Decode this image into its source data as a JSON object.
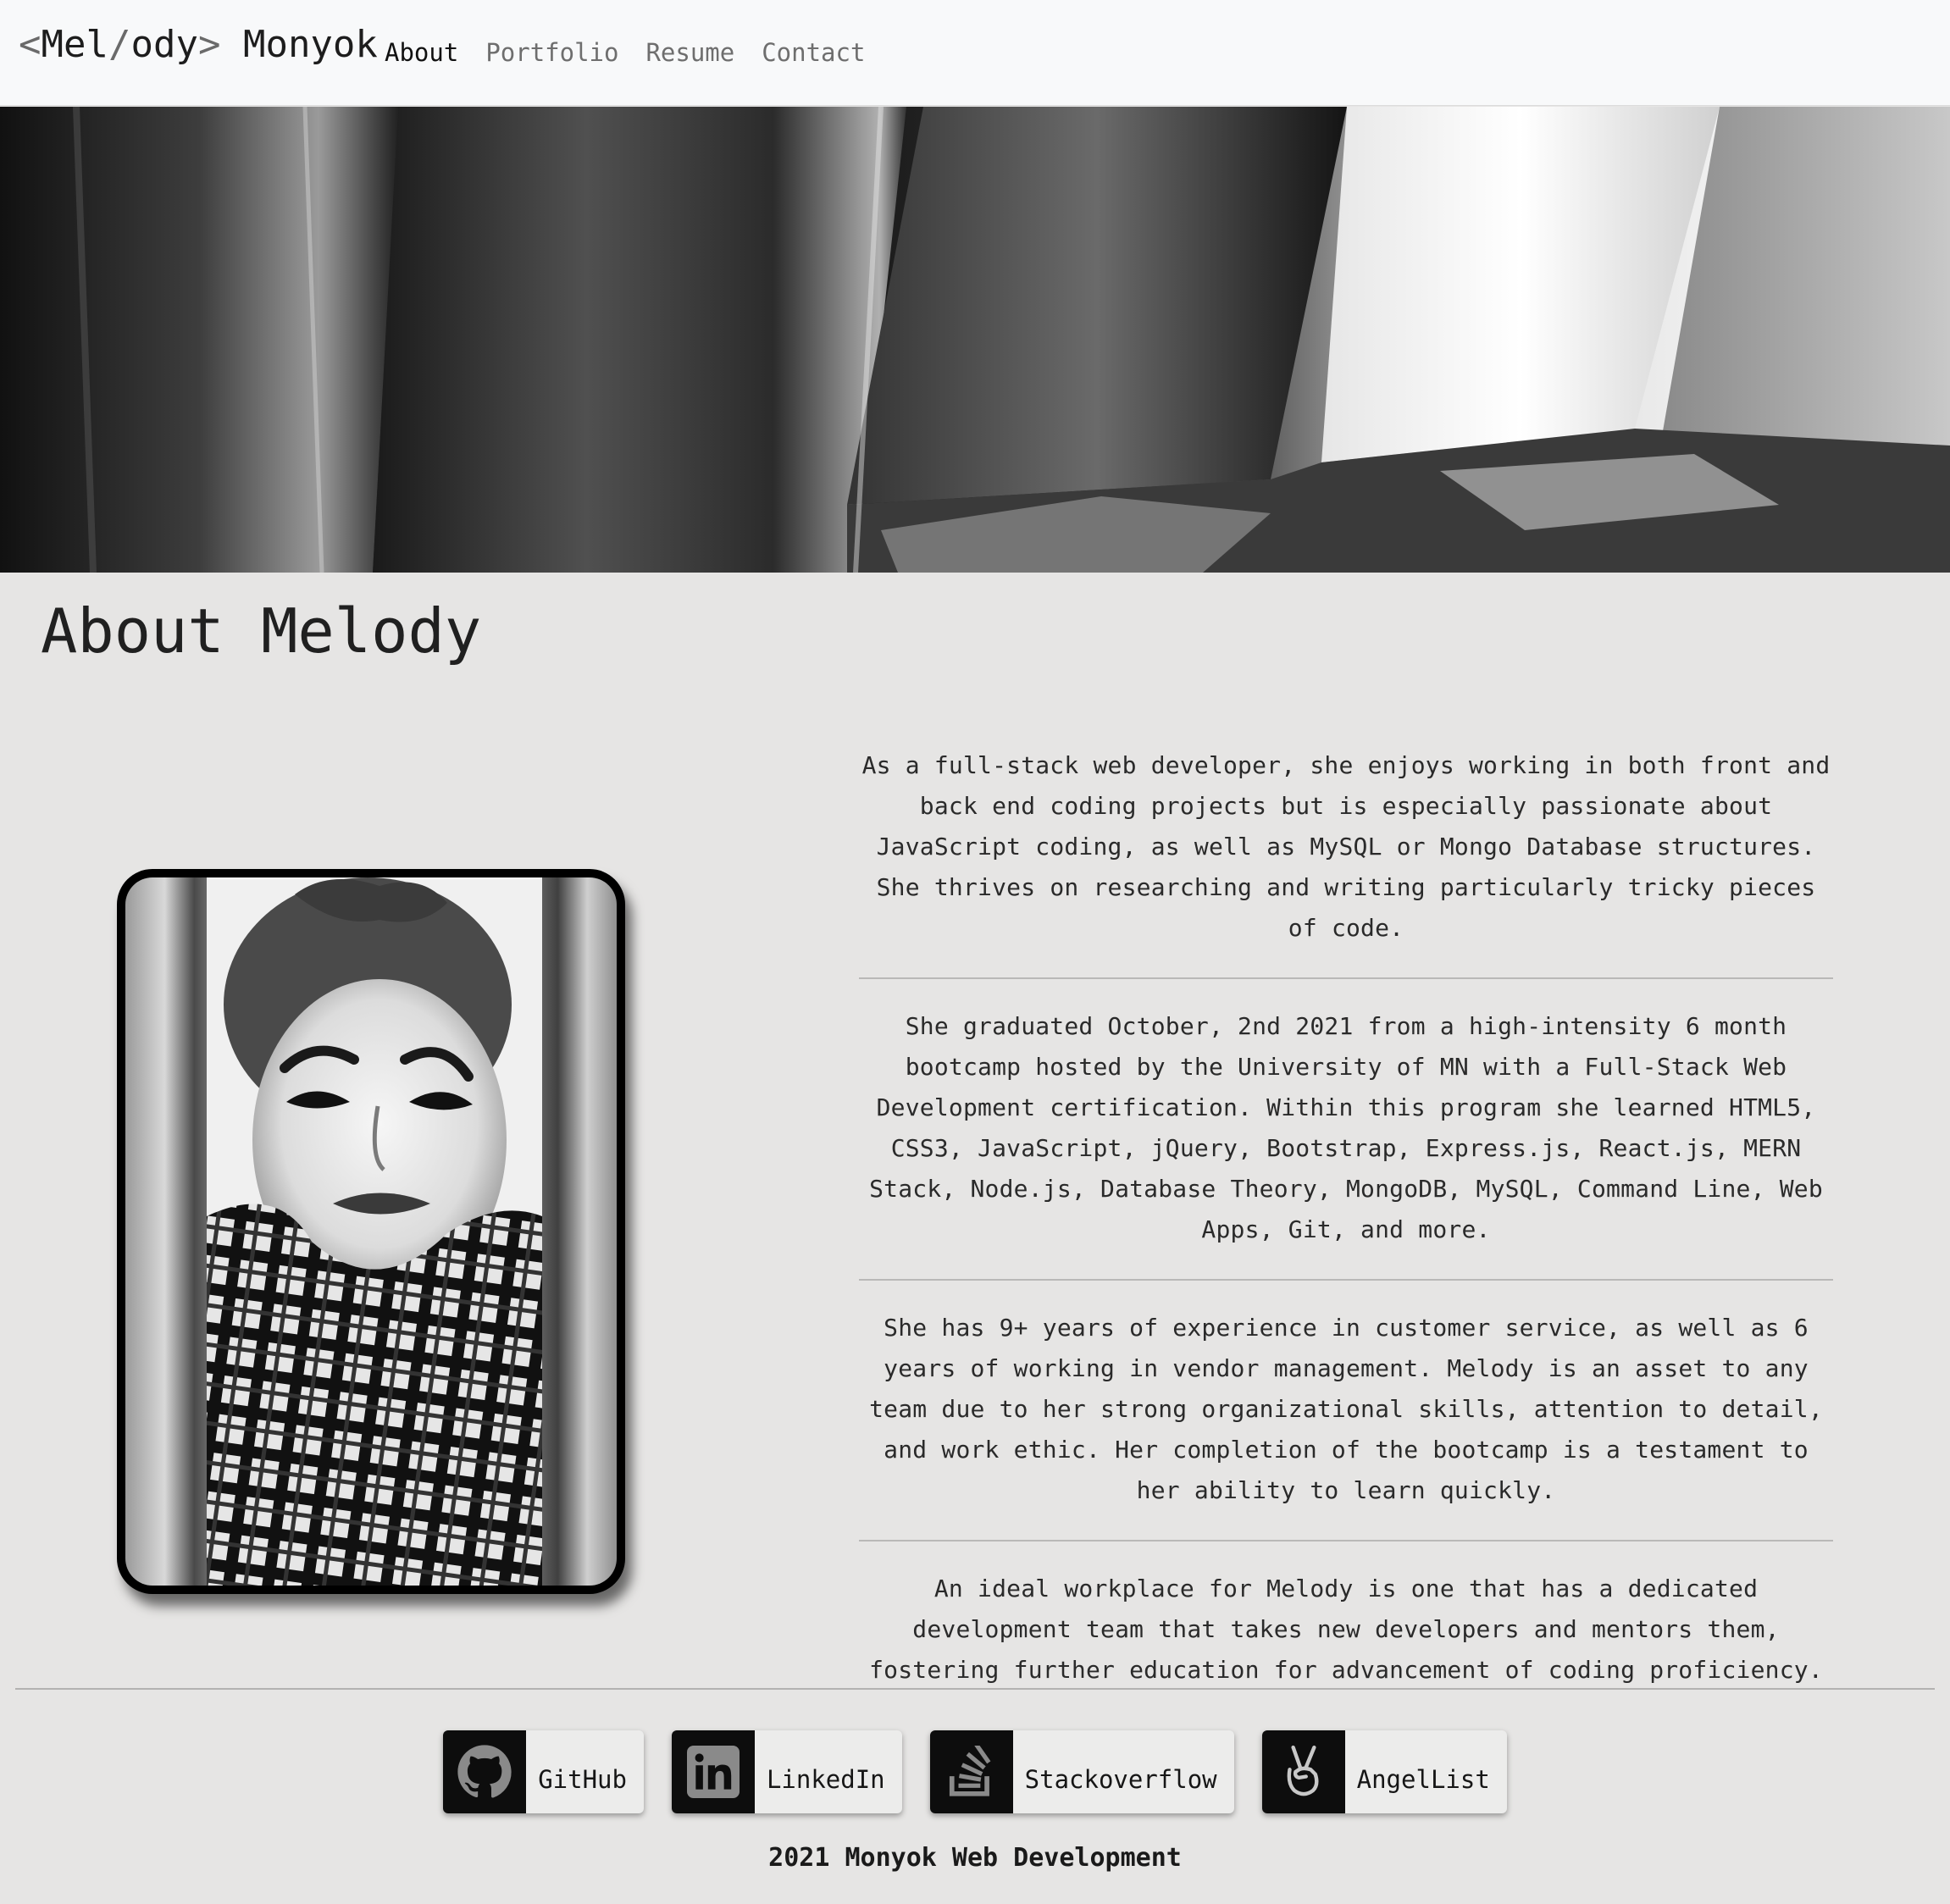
{
  "nav": {
    "brand_open": "<",
    "brand_mel": "Mel",
    "brand_slash": "/",
    "brand_ody": "ody",
    "brand_close": ">",
    "brand_last": " Monyok",
    "links": [
      {
        "label": "About",
        "active": true
      },
      {
        "label": "Portfolio",
        "active": false
      },
      {
        "label": "Resume",
        "active": false
      },
      {
        "label": "Contact",
        "active": false
      }
    ]
  },
  "about": {
    "title": "About Melody",
    "paragraphs": [
      "As a full-stack web developer, she enjoys working in both front and back end coding projects but is especially passionate about JavaScript coding, as well as MySQL or Mongo Database structures. She thrives on researching and writing particularly tricky pieces of code.",
      "She graduated October, 2nd 2021 from a high-intensity 6 month bootcamp hosted by the University of MN with a Full-Stack Web Development certification. Within this program she learned HTML5, CSS3, JavaScript, jQuery, Bootstrap, Express.js, React.js, MERN Stack, Node.js, Database Theory, MongoDB, MySQL, Command Line, Web Apps, Git, and more.",
      "She has 9+ years of experience in customer service, as well as 6 years of working in vendor management. Melody is an asset to any team due to her strong organizational skills, attention to detail, and work ethic. Her completion of the bootcamp is a testament to her ability to learn quickly.",
      "An ideal workplace for Melody is one that has a dedicated development team that takes new developers and mentors them, fostering further education for advancement of coding proficiency."
    ]
  },
  "footer": {
    "socials": [
      {
        "label": "GitHub",
        "icon": "github-icon"
      },
      {
        "label": "LinkedIn",
        "icon": "linkedin-icon"
      },
      {
        "label": "Stackoverflow",
        "icon": "stackoverflow-icon"
      },
      {
        "label": "AngelList",
        "icon": "angellist-icon"
      }
    ],
    "copyright": "2021 Monyok Web Development"
  }
}
